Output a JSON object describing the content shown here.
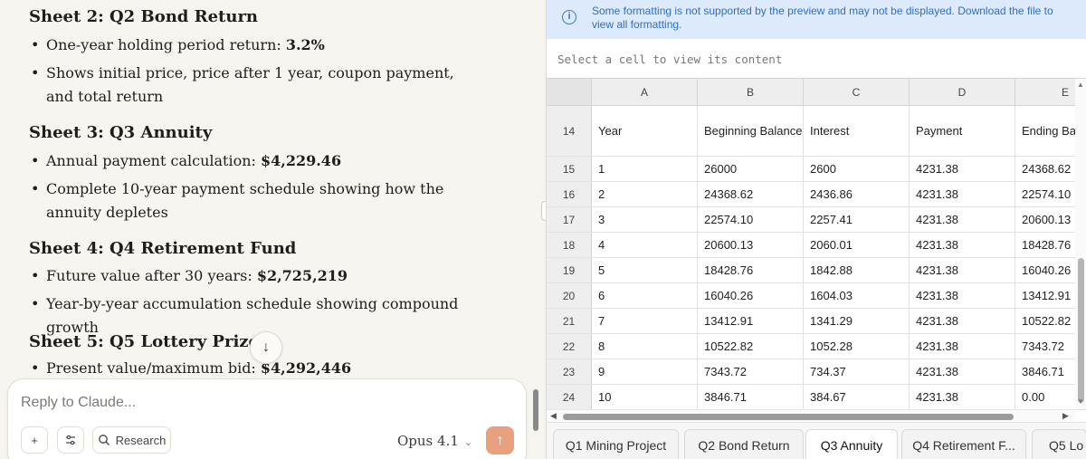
{
  "chat": {
    "sections": [
      {
        "heading": "Sheet 2: Q2 Bond Return",
        "bullets": [
          {
            "text": "One-year holding period return: ",
            "bold": "3.2%"
          },
          {
            "text": "Shows initial price, price after 1 year, coupon payment, and total return",
            "bold": ""
          }
        ]
      },
      {
        "heading": "Sheet 3: Q3 Annuity",
        "bullets": [
          {
            "text": "Annual payment calculation: ",
            "bold": "$4,229.46"
          },
          {
            "text": "Complete 10-year payment schedule showing how the annuity depletes",
            "bold": ""
          }
        ]
      },
      {
        "heading": "Sheet 4: Q4 Retirement Fund",
        "bullets": [
          {
            "text": "Future value after 30 years: ",
            "bold": "$2,725,219"
          },
          {
            "text": "Year-by-year accumulation schedule showing compound growth",
            "bold": ""
          }
        ]
      },
      {
        "heading": "Sheet 5: Q5 Lottery Prize",
        "bullets": [
          {
            "text": "Present value/maximum bid: ",
            "bold": "$4,292,446"
          }
        ]
      }
    ],
    "composer": {
      "placeholder": "Reply to Claude...",
      "research_label": "Research",
      "model_label": "Opus 4.1"
    }
  },
  "sheet": {
    "notice": "Some formatting is not supported by the preview and may not be displayed. Download the file to view all formatting.",
    "cell_view_placeholder": "Select a cell to view its content",
    "columns": [
      "A",
      "B",
      "C",
      "D",
      "E"
    ],
    "rows": [
      {
        "n": "14",
        "cells": [
          "Year",
          "Beginning Balance",
          "Interest",
          "Payment",
          "Ending Ba"
        ]
      },
      {
        "n": "15",
        "cells": [
          "1",
          "26000",
          "2600",
          "4231.38",
          "24368.62"
        ]
      },
      {
        "n": "16",
        "cells": [
          "2",
          "24368.62",
          "2436.86",
          "4231.38",
          "22574.10"
        ]
      },
      {
        "n": "17",
        "cells": [
          "3",
          "22574.10",
          "2257.41",
          "4231.38",
          "20600.13"
        ]
      },
      {
        "n": "18",
        "cells": [
          "4",
          "20600.13",
          "2060.01",
          "4231.38",
          "18428.76"
        ]
      },
      {
        "n": "19",
        "cells": [
          "5",
          "18428.76",
          "1842.88",
          "4231.38",
          "16040.26"
        ]
      },
      {
        "n": "20",
        "cells": [
          "6",
          "16040.26",
          "1604.03",
          "4231.38",
          "13412.91"
        ]
      },
      {
        "n": "21",
        "cells": [
          "7",
          "13412.91",
          "1341.29",
          "4231.38",
          "10522.82"
        ]
      },
      {
        "n": "22",
        "cells": [
          "8",
          "10522.82",
          "1052.28",
          "4231.38",
          "7343.72"
        ]
      },
      {
        "n": "23",
        "cells": [
          "9",
          "7343.72",
          "734.37",
          "4231.38",
          "3846.71"
        ]
      },
      {
        "n": "24",
        "cells": [
          "10",
          "3846.71",
          "384.67",
          "4231.38",
          "0.00"
        ]
      }
    ],
    "tabs": [
      "Q1 Mining Project",
      "Q2 Bond Return",
      "Q3 Annuity",
      "Q4 Retirement F...",
      "Q5 Lo"
    ],
    "active_tab": "Q3 Annuity"
  },
  "colors": {
    "accent_send": "#e8a07f",
    "notice_bg": "#dceafc",
    "notice_text": "#2f6fbe"
  }
}
